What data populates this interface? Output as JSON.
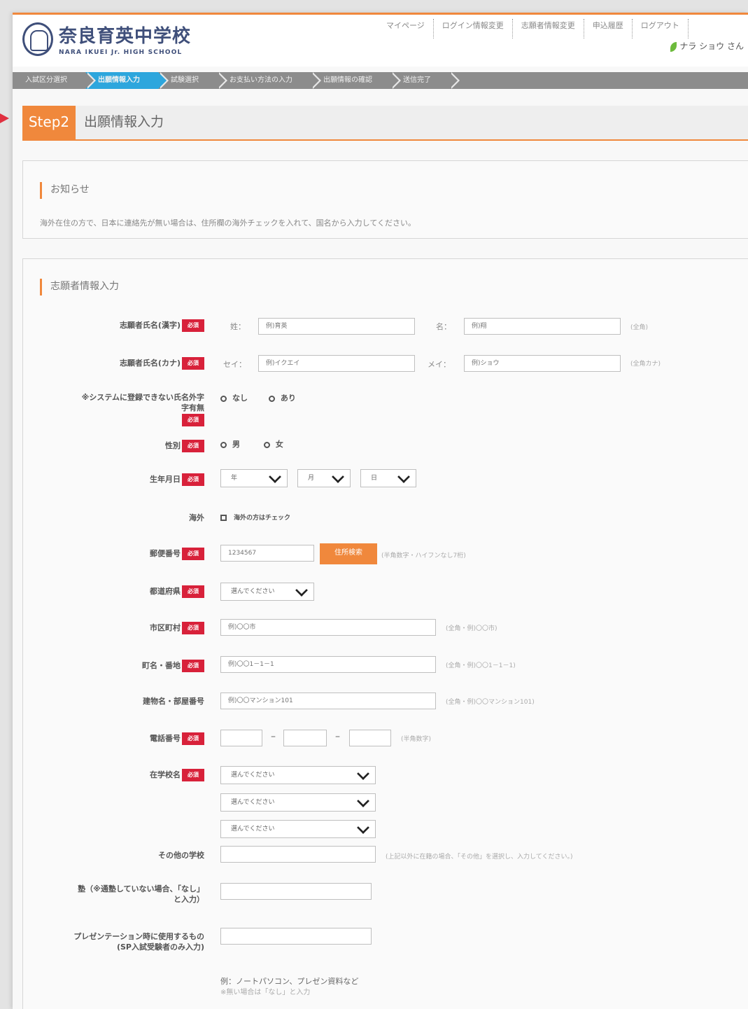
{
  "header": {
    "logo_jp": "奈良育英中学校",
    "logo_en": "NARA IKUEI Jr. HIGH SCHOOL",
    "nav": [
      "マイページ",
      "ログイン情報変更",
      "志願者情報変更",
      "申込履歴",
      "ログアウト"
    ],
    "user": "ナラ ショウ さん"
  },
  "steps": [
    "入試区分選択",
    "出願情報入力",
    "試験選択",
    "お支払い方法の入力",
    "出願情報の確認",
    "送信完了"
  ],
  "active_step": 1,
  "stepbar": {
    "badge": "Step2",
    "title": "出願情報入力"
  },
  "notice": {
    "title": "お知らせ",
    "text": "海外在住の方で、日本に連絡先が無い場合は、住所欄の海外チェックを入れて、国名から入力してください。"
  },
  "form": {
    "title": "志願者情報入力",
    "required_badge": "必須",
    "name_kanji": {
      "label": "志願者氏名(漢字)",
      "sei_label": "姓：",
      "sei_placeholder": "例)育英",
      "mei_label": "名：",
      "mei_placeholder": "例)翔",
      "note": "(全角)"
    },
    "name_kana": {
      "label": "志願者氏名(カナ)",
      "sei_label": "セイ：",
      "sei_placeholder": "例)イクエイ",
      "mei_label": "メイ：",
      "mei_placeholder": "例)ショウ",
      "note": "(全角カナ)"
    },
    "unregistered": {
      "label_line1": "※システムに登録できない氏名外字",
      "label_line2": "字有無",
      "options": [
        "なし",
        "あり"
      ]
    },
    "gender": {
      "label": "性別",
      "options": [
        "男",
        "女"
      ]
    },
    "birthday": {
      "label": "生年月日",
      "values": [
        "年",
        "月",
        "日"
      ]
    },
    "overseas": {
      "label": "海外",
      "checkbox": "海外の方はチェック"
    },
    "postal": {
      "label": "郵便番号",
      "placeholder": "1234567",
      "button": "住所検索",
      "note": "(半角数字・ハイフンなし7桁)"
    },
    "prefecture": {
      "label": "都道府県",
      "value": "選んでください"
    },
    "city": {
      "label": "市区町村",
      "placeholder": "例)〇〇市",
      "note": "(全角・例)〇〇市)"
    },
    "town": {
      "label": "町名・番地",
      "placeholder": "例)〇〇1－1－1",
      "note": "(全角・例)〇〇1－1－1)"
    },
    "building": {
      "label": "建物名・部屋番号",
      "placeholder": "例)〇〇マンション101",
      "note": "(全角・例)〇〇マンション101)"
    },
    "phone": {
      "label": "電話番号",
      "note": "(半角数字)"
    },
    "school": {
      "label": "在学校名",
      "values": [
        "選んでください",
        "選んでください",
        "選んでください"
      ]
    },
    "other_school": {
      "label": "その他の学校",
      "note": "(上記以外に在籍の場合、「その他」を選択し、入力してください。)"
    },
    "cram": {
      "label_line1": "塾（※通塾していない場合、「なし」",
      "label_line2": "と入力）"
    },
    "presentation": {
      "label_line1": "プレゼンテーション時に使用するもの",
      "label_line2": "(SP入試受験者のみ入力)"
    },
    "example_line1": "例：ノートパソコン、プレゼン資料など",
    "example_line2": "※無い場合は「なし」と入力"
  }
}
